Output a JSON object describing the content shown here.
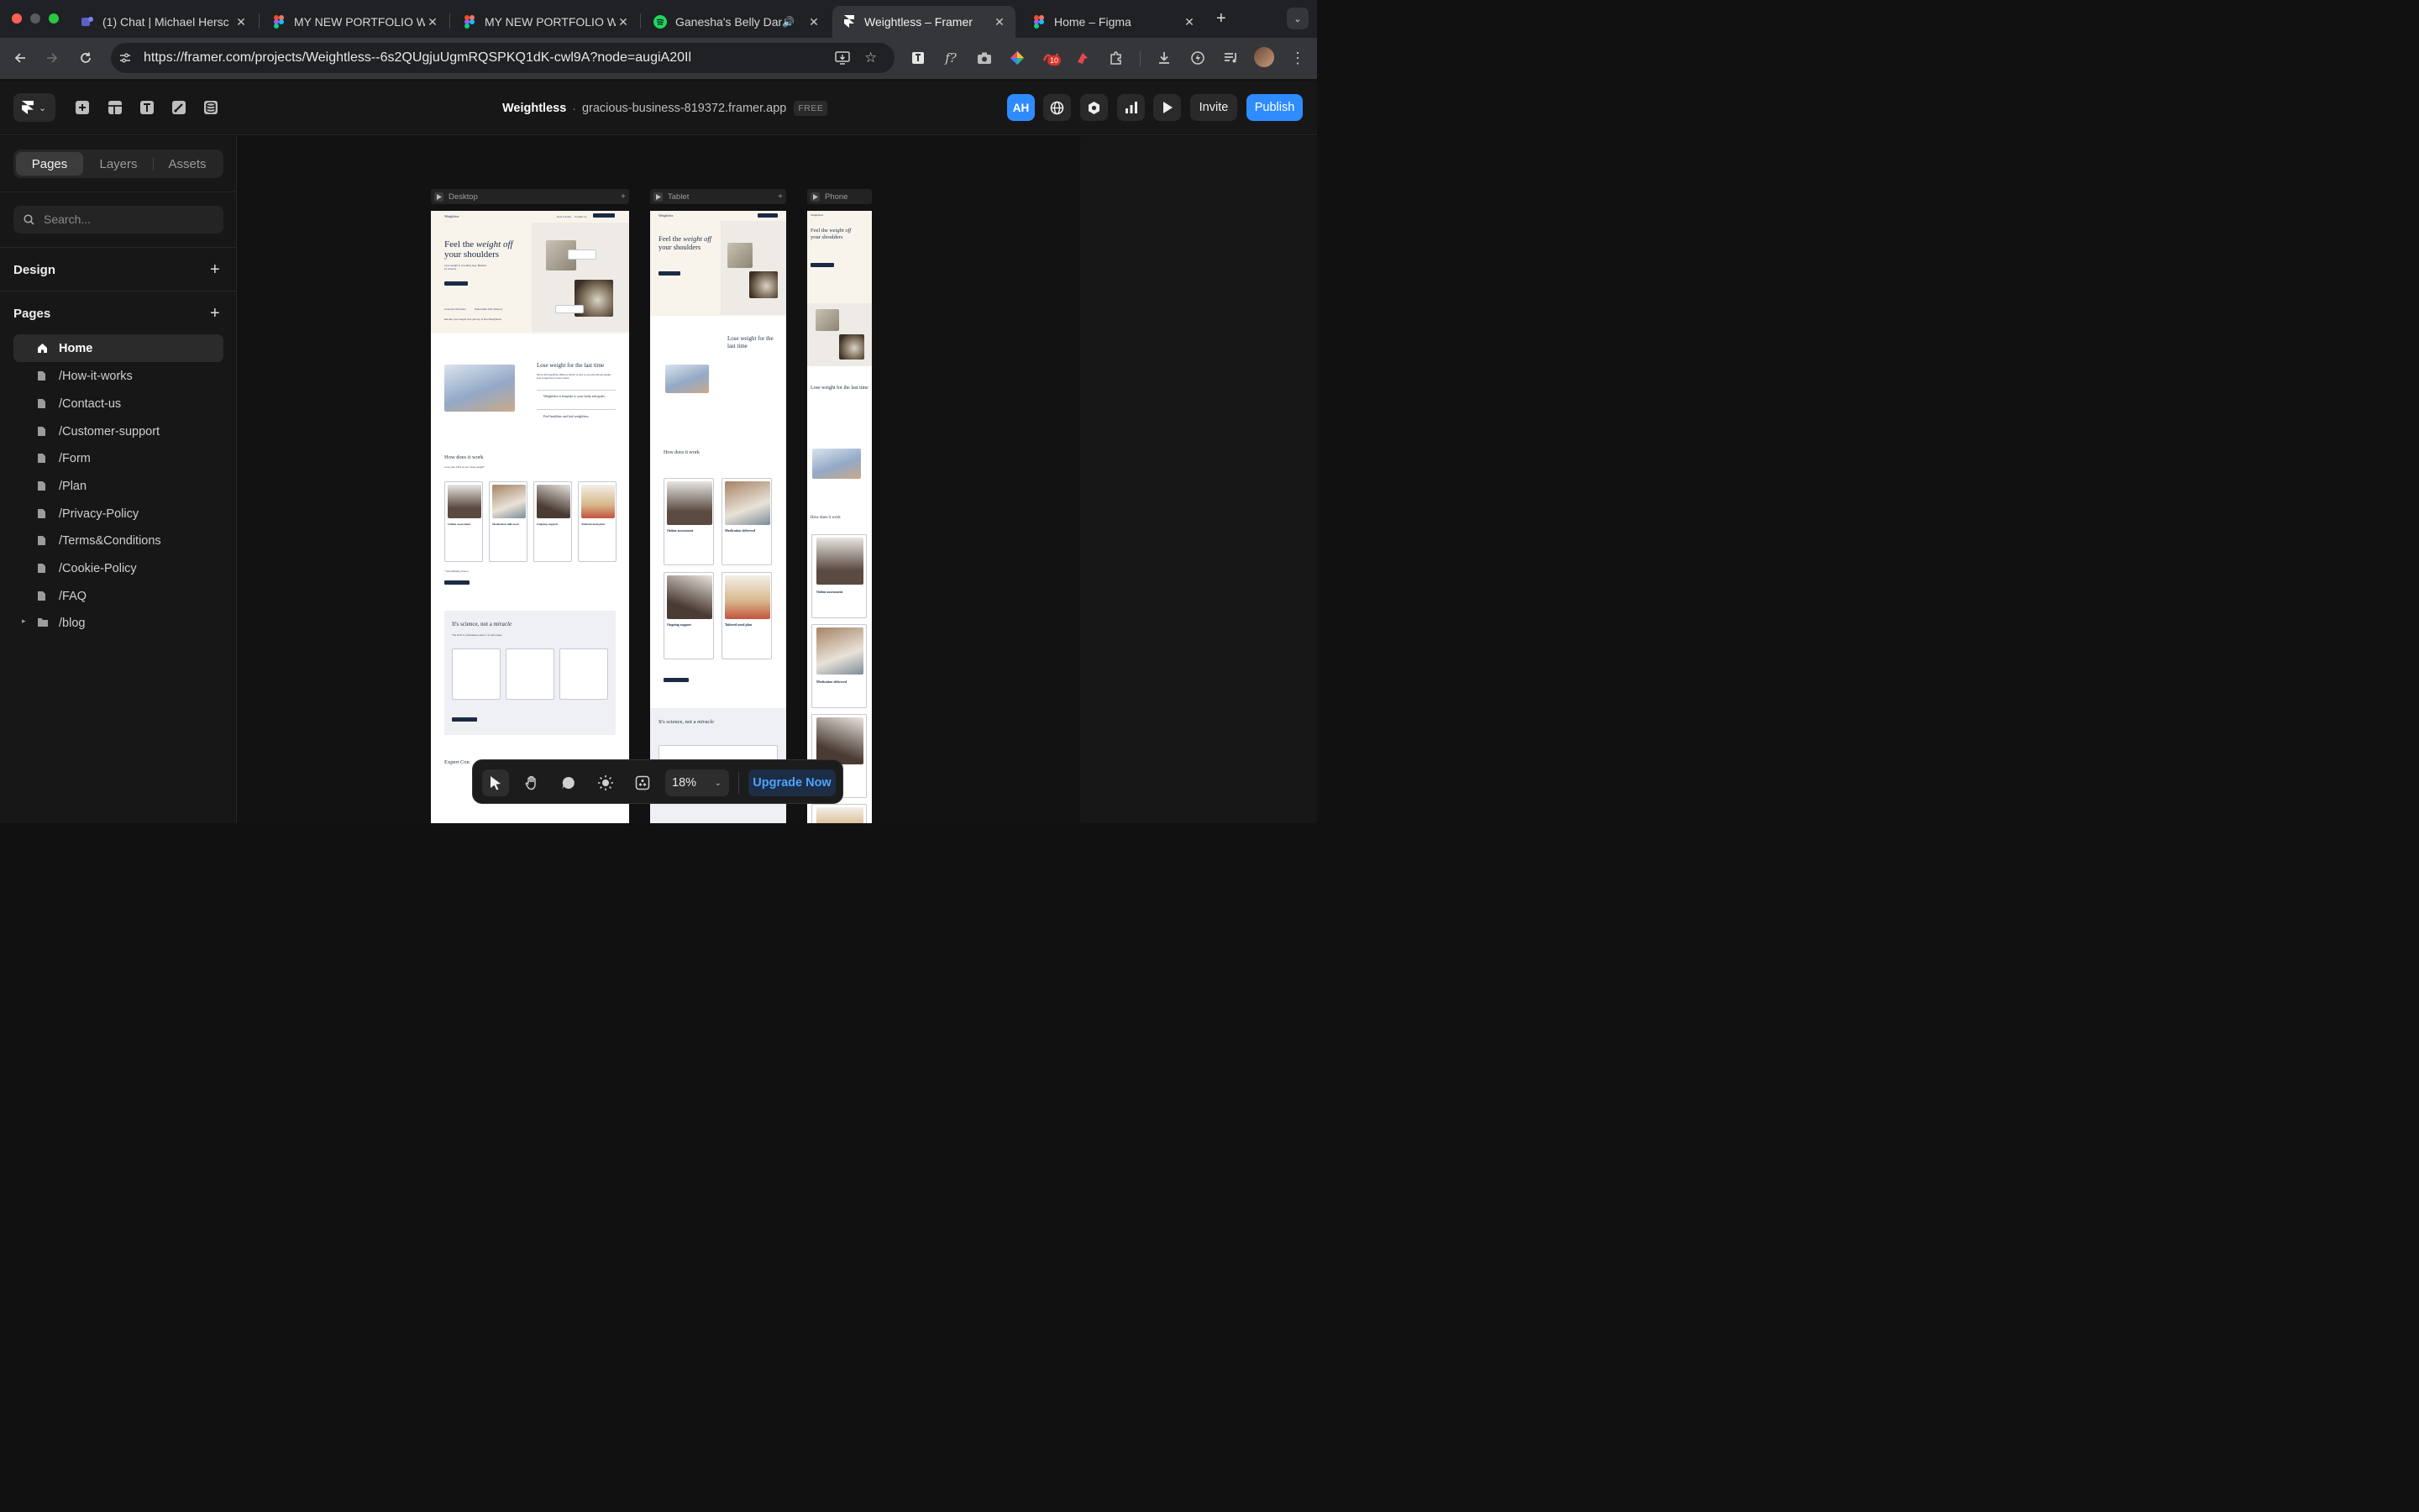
{
  "browser": {
    "tabs": [
      {
        "title": "(1) Chat | Michael Hersc",
        "icon": "teams-icon",
        "active": false
      },
      {
        "title": "MY NEW PORTFOLIO W",
        "icon": "figma-icon",
        "active": false
      },
      {
        "title": "MY NEW PORTFOLIO W",
        "icon": "figma-icon",
        "active": false
      },
      {
        "title": "Ganesha's Belly Dan",
        "icon": "spotify-icon",
        "active": false
      },
      {
        "title": "Weightless – Framer",
        "icon": "framer-icon",
        "active": true
      },
      {
        "title": "Home – Figma",
        "icon": "figma-icon",
        "active": false
      }
    ],
    "url": "https://framer.com/projects/Weightless--6s2QUgjuUgmRQSPKQ1dK-cwl9A?node=augiA20Il",
    "extension_badge": "10"
  },
  "framer": {
    "project_name": "Weightless",
    "separator": "·",
    "domain": "gracious-business-819372.framer.app",
    "plan_badge": "FREE",
    "avatar_initials": "AH",
    "invite_label": "Invite",
    "publish_label": "Publish",
    "accent": "#2f8cff"
  },
  "left_panel": {
    "tabs": [
      "Pages",
      "Layers",
      "Assets"
    ],
    "active_tab": "Pages",
    "search_placeholder": "Search...",
    "design_header": "Design",
    "pages_header": "Pages",
    "pages": [
      {
        "label": "Home",
        "icon": "home-icon",
        "selected": true
      },
      {
        "label": "/How-it-works",
        "icon": "page-icon"
      },
      {
        "label": "/Contact-us",
        "icon": "page-icon"
      },
      {
        "label": "/Customer-support",
        "icon": "page-icon"
      },
      {
        "label": "/Form",
        "icon": "page-icon"
      },
      {
        "label": "/Plan",
        "icon": "page-icon"
      },
      {
        "label": "/Privacy-Policy",
        "icon": "page-icon"
      },
      {
        "label": "/Terms&Conditions",
        "icon": "page-icon"
      },
      {
        "label": "/Cookie-Policy",
        "icon": "page-icon"
      },
      {
        "label": "/FAQ",
        "icon": "page-icon"
      },
      {
        "label": "/blog",
        "icon": "folder-icon"
      }
    ]
  },
  "canvas": {
    "breakpoints": [
      "Desktop",
      "Tablet",
      "Phone"
    ],
    "site": {
      "logo": "Weightless",
      "nav": [
        "How it works",
        "Contact us"
      ],
      "cta": "Join Weightless",
      "hero_title_a": "Feel the",
      "hero_title_b": "weight off",
      "hero_title_c": "your shoulders",
      "hero_sub": "Lose weight in a healthy way. Backed by science.",
      "hero_check_1": "Licensed Clinicians",
      "hero_check_2": "Nationwide 24hr Delivery",
      "hero_note": "Elevate your weight loss journey & Feel Weightless",
      "section2_title": "Lose weight for the last time",
      "section2_text": "We're all beautifully different which is why a one-size-fits-all weight loss programme never works.",
      "section2_point1": "Weightless is bespoke to your body and goals.",
      "section2_point2": "Feel healthier and feel weightless.",
      "how_title": "How does it work",
      "how_sub": "Lose upto 15% of your body weight*",
      "steps": [
        {
          "title": "Online assessment",
          "num": "1"
        },
        {
          "title": "Medication delivered",
          "num": "2"
        },
        {
          "title": "Ongoing support",
          "num": "3"
        },
        {
          "title": "Tailored meal plan",
          "num": "4"
        }
      ],
      "footnote": "* Scientifically proven.",
      "science_title_a": "It's science, not a",
      "science_title_b": "miracle",
      "science_sub": "The GLP-1 medications work in 3 main ways:",
      "expert_title": "Expert Con"
    }
  },
  "bottom_toolbar": {
    "zoom": "18%",
    "upgrade_label": "Upgrade Now"
  }
}
